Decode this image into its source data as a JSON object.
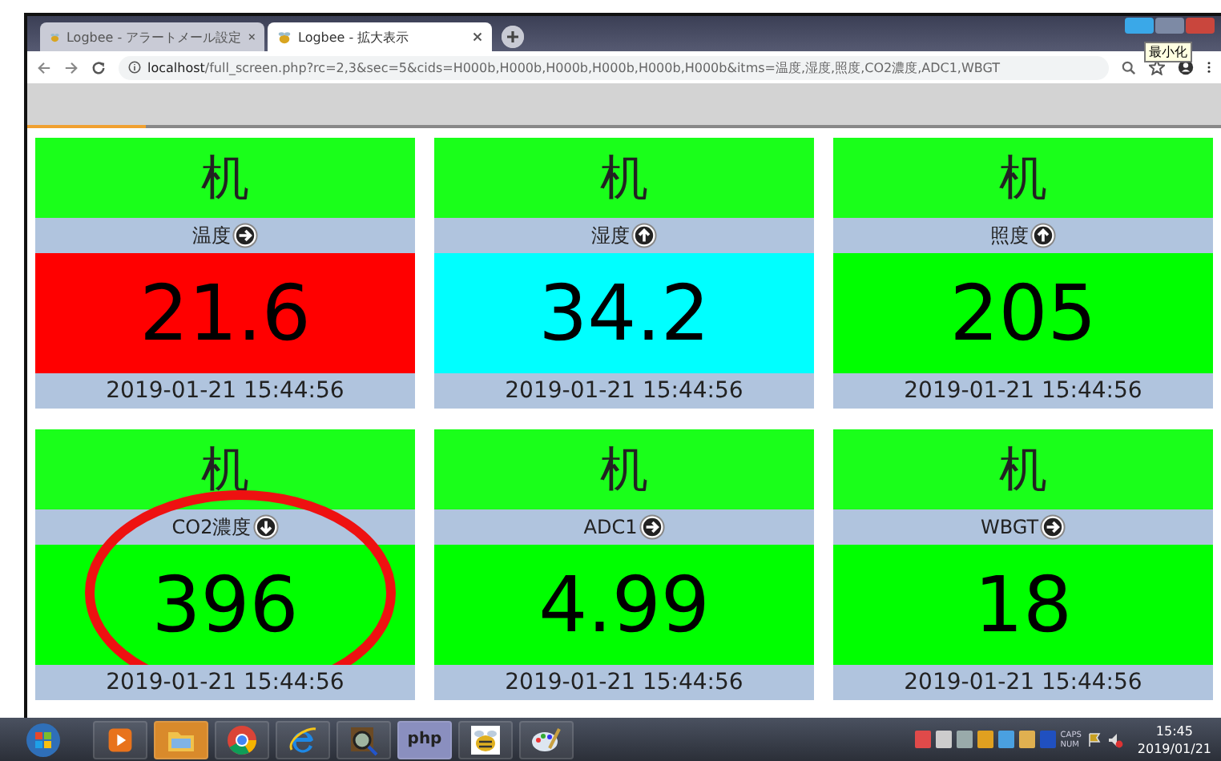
{
  "browser": {
    "tabs": [
      {
        "title": "Logbee - アラートメール設定",
        "selected": false
      },
      {
        "title": "Logbee - 拡大表示",
        "selected": true
      }
    ],
    "address": {
      "host": "localhost",
      "path": "/full_screen.php?rc=2,3&sec=5&cids=H000b,H000b,H000b,H000b,H000b,H000b&itms=温度,湿度,照度,CO2濃度,ADC1,WBGT"
    },
    "tooltip": "最小化"
  },
  "cards": [
    {
      "name": "机",
      "label": "温度",
      "kind": "right",
      "value": "21.6",
      "color": "#ff0000",
      "time": "2019-01-21 15:44:56"
    },
    {
      "name": "机",
      "label": "湿度",
      "kind": "up",
      "value": "34.2",
      "color": "#00ffff",
      "time": "2019-01-21 15:44:56"
    },
    {
      "name": "机",
      "label": "照度",
      "kind": "up",
      "value": "205",
      "color": "#00ff00",
      "time": "2019-01-21 15:44:56"
    },
    {
      "name": "机",
      "label": "CO2濃度",
      "kind": "down",
      "value": "396",
      "color": "#00ff00",
      "time": "2019-01-21 15:44:56"
    },
    {
      "name": "机",
      "label": "ADC1",
      "kind": "right",
      "value": "4.99",
      "color": "#00ff00",
      "time": "2019-01-21 15:44:56"
    },
    {
      "name": "机",
      "label": "WBGT",
      "kind": "right",
      "value": "18",
      "color": "#00ff00",
      "time": "2019-01-21 15:44:56"
    }
  ],
  "taskbar": {
    "apps": [
      {
        "kind": "media",
        "selected": false
      },
      {
        "kind": "folder",
        "selected": true
      },
      {
        "kind": "chrome",
        "selected": false
      },
      {
        "kind": "ie",
        "selected": false
      },
      {
        "kind": "magnifier",
        "selected": false
      },
      {
        "kind": "text",
        "label": "php",
        "selected": false
      },
      {
        "kind": "bee",
        "selected": false
      },
      {
        "kind": "paint",
        "selected": false
      }
    ],
    "locks": [
      "CAPS",
      "NUM"
    ],
    "clock": {
      "time": "15:45",
      "date": "2019/01/21"
    }
  }
}
